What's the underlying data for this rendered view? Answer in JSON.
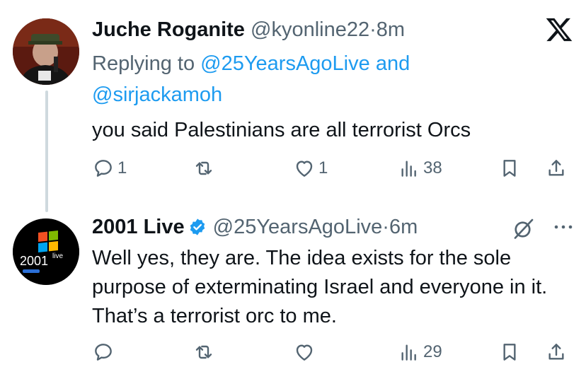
{
  "tweets": [
    {
      "name": "Juche Roganite",
      "handle": "@kyonline22",
      "separator": "·",
      "time": "8m",
      "replying_prefix": "Replying to",
      "replying_to_1": "@25YearsAgoLive",
      "replying_and": "and",
      "replying_to_2": "@sirjackamoh",
      "text": "you said Palestinians are all terrorist Orcs",
      "reply_count": "1",
      "retweet_count": "",
      "like_count": "1",
      "view_count": "38"
    },
    {
      "name": "2001 Live",
      "handle": "@25YearsAgoLive",
      "separator": "·",
      "time": "6m",
      "text": "Well yes, they are. The idea exists for the sole purpose of exterminating Israel and everyone in it. That’s a terrorist orc to me.",
      "avatar_text": "2001",
      "avatar_sup": "live",
      "reply_count": "",
      "retweet_count": "",
      "like_count": "",
      "view_count": "29"
    }
  ],
  "colors": {
    "text": "#0f1419",
    "muted": "#536471",
    "link": "#1d9bf0",
    "verified": "#1d9bf0",
    "thread_line": "#cfd9de"
  },
  "icons": [
    "x-logo-icon",
    "reply-icon",
    "retweet-icon",
    "like-icon",
    "views-icon",
    "bookmark-icon",
    "share-icon",
    "verified-badge-icon",
    "grok-icon",
    "more-icon"
  ]
}
